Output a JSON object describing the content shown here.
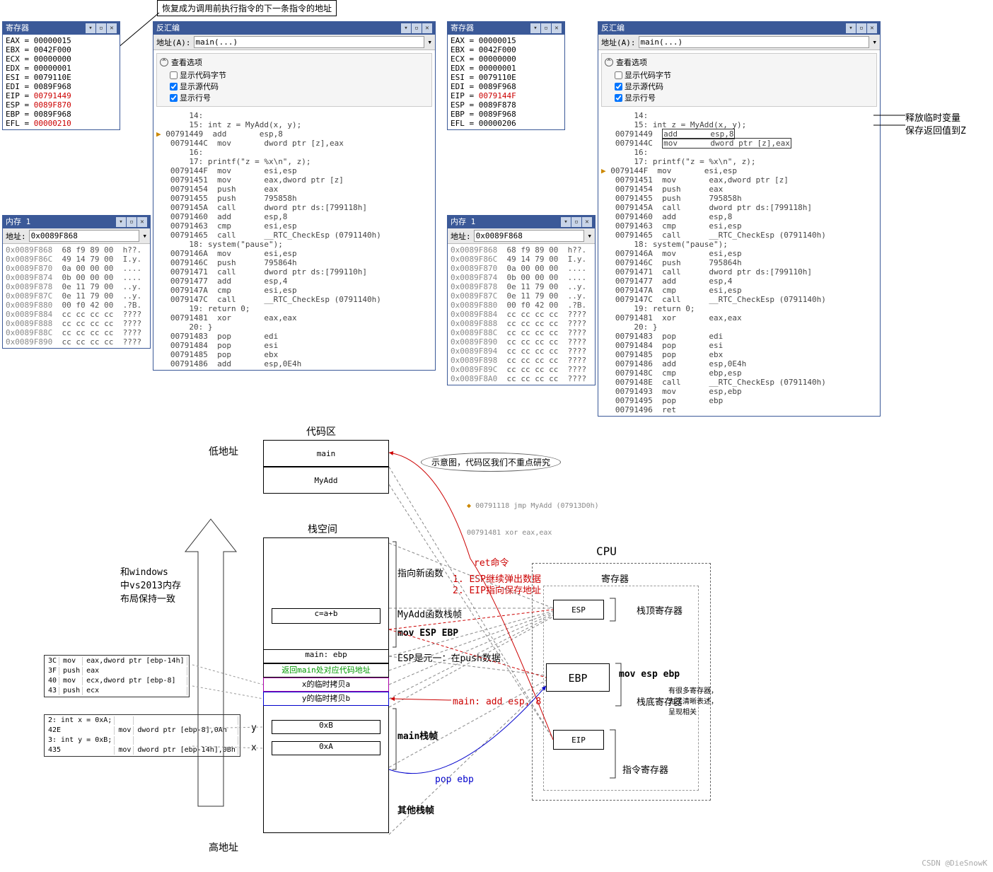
{
  "annot_top": "恢复成为调用前执行指令的下一条指令的地址",
  "annot_right1": "释放临时变量",
  "annot_right2": "保存返回值到Z",
  "left": {
    "registers": {
      "title": "寄存器",
      "lines": [
        {
          "t": "EAX = 00000015"
        },
        {
          "t": "EBX = 0042F000"
        },
        {
          "t": "ECX = 00000000"
        },
        {
          "t": "EDX = 00000001"
        },
        {
          "t": "ESI = 0079110E"
        },
        {
          "t": "EDI = 0089F968"
        },
        {
          "t": "EIP = ",
          "v": "00791449",
          "hl": true
        },
        {
          "t": "ESP = ",
          "v": "0089F870",
          "hl": true
        },
        {
          "t": "EBP = 0089F968"
        },
        {
          "t": "EFL = ",
          "v": "00000210",
          "hl": true
        }
      ]
    },
    "memory": {
      "title": "内存 1",
      "addr_label": "地址:",
      "addr_value": "0x0089F868",
      "lines": [
        [
          "0x0089F868",
          "68 f9 89 00",
          "h??."
        ],
        [
          "0x0089F86C",
          "49 14 79 00",
          "I.y."
        ],
        [
          "0x0089F870",
          "0a 00 00 00",
          "...."
        ],
        [
          "0x0089F874",
          "0b 00 00 00",
          "...."
        ],
        [
          "0x0089F878",
          "0e 11 79 00",
          "..y."
        ],
        [
          "0x0089F87C",
          "0e 11 79 00",
          "..y."
        ],
        [
          "0x0089F880",
          "00 f0 42 00",
          ".?B."
        ],
        [
          "0x0089F884",
          "cc cc cc cc",
          "????"
        ],
        [
          "0x0089F888",
          "cc cc cc cc",
          "????"
        ],
        [
          "0x0089F88C",
          "cc cc cc cc",
          "????"
        ],
        [
          "0x0089F890",
          "cc cc cc cc",
          "????"
        ]
      ]
    },
    "disasm": {
      "title": "反汇编",
      "addr_label": "地址(A):",
      "addr_value": "main(...)",
      "opts_title": "查看选项",
      "opt1": "显示代码字节",
      "opt2": "显示源代码",
      "opt3": "显示行号",
      "lines": [
        "      14:",
        "      15: int z = MyAdd(x, y);",
        "▶ 00791449  add       esp,8",
        "  0079144C  mov       dword ptr [z],eax",
        "      16:",
        "      17: printf(\"z = %x\\n\", z);",
        "  0079144F  mov       esi,esp",
        "  00791451  mov       eax,dword ptr [z]",
        "  00791454  push      eax",
        "  00791455  push      795858h",
        "  0079145A  call      dword ptr ds:[799118h]",
        "  00791460  add       esp,8",
        "  00791463  cmp       esi,esp",
        "  00791465  call      __RTC_CheckEsp (0791140h)",
        "      18: system(\"pause\");",
        "  0079146A  mov       esi,esp",
        "  0079146C  push      795864h",
        "  00791471  call      dword ptr ds:[799110h]",
        "  00791477  add       esp,4",
        "  0079147A  cmp       esi,esp",
        "  0079147C  call      __RTC_CheckEsp (0791140h)",
        "      19: return 0;",
        "  00791481  xor       eax,eax",
        "      20: }",
        "  00791483  pop       edi",
        "  00791484  pop       esi",
        "  00791485  pop       ebx",
        "  00791486  add       esp,0E4h"
      ]
    }
  },
  "right": {
    "registers": {
      "title": "寄存器",
      "lines": [
        {
          "t": "EAX = 00000015"
        },
        {
          "t": "EBX = 0042F000"
        },
        {
          "t": "ECX = 00000000"
        },
        {
          "t": "EDX = 00000001"
        },
        {
          "t": "ESI = 0079110E"
        },
        {
          "t": "EDI = 0089F968"
        },
        {
          "t": "EIP = ",
          "v": "0079144F",
          "hl": true
        },
        {
          "t": "ESP = 0089F878"
        },
        {
          "t": "EBP = 0089F968"
        },
        {
          "t": "EFL = 00000206"
        }
      ]
    },
    "memory": {
      "title": "内存 1",
      "addr_label": "地址:",
      "addr_value": "0x0089F868",
      "lines": [
        [
          "0x0089F868",
          "68 f9 89 00",
          "h??."
        ],
        [
          "0x0089F86C",
          "49 14 79 00",
          "I.y."
        ],
        [
          "0x0089F870",
          "0a 00 00 00",
          "...."
        ],
        [
          "0x0089F874",
          "0b 00 00 00",
          "...."
        ],
        [
          "0x0089F878",
          "0e 11 79 00",
          "..y."
        ],
        [
          "0x0089F87C",
          "0e 11 79 00",
          "..y."
        ],
        [
          "0x0089F880",
          "00 f0 42 00",
          ".?B."
        ],
        [
          "0x0089F884",
          "cc cc cc cc",
          "????"
        ],
        [
          "0x0089F888",
          "cc cc cc cc",
          "????"
        ],
        [
          "0x0089F88C",
          "cc cc cc cc",
          "????"
        ],
        [
          "0x0089F890",
          "cc cc cc cc",
          "????"
        ],
        [
          "0x0089F894",
          "cc cc cc cc",
          "????"
        ],
        [
          "0x0089F898",
          "cc cc cc cc",
          "????"
        ],
        [
          "0x0089F89C",
          "cc cc cc cc",
          "????"
        ],
        [
          "0x0089F8A0",
          "cc cc cc cc",
          "????"
        ]
      ]
    },
    "disasm": {
      "title": "反汇编",
      "addr_label": "地址(A):",
      "addr_value": "main(...)",
      "opts_title": "查看选项",
      "opt1": "显示代码字节",
      "opt2": "显示源代码",
      "opt3": "显示行号",
      "hl1": "add       esp,8",
      "hl2": "mov       dword ptr [z],eax",
      "lines": [
        "      14:",
        "      15: int z = MyAdd(x, y);",
        "  00791449  ",
        "  0079144C  ",
        "      16:",
        "      17: printf(\"z = %x\\n\", z);",
        "▶ 0079144F  mov       esi,esp",
        "  00791451  mov       eax,dword ptr [z]",
        "  00791454  push      eax",
        "  00791455  push      795858h",
        "  0079145A  call      dword ptr ds:[799118h]",
        "  00791460  add       esp,8",
        "  00791463  cmp       esi,esp",
        "  00791465  call      __RTC_CheckEsp (0791140h)",
        "      18: system(\"pause\");",
        "  0079146A  mov       esi,esp",
        "  0079146C  push      795864h",
        "  00791471  call      dword ptr ds:[799110h]",
        "  00791477  add       esp,4",
        "  0079147A  cmp       esi,esp",
        "  0079147C  call      __RTC_CheckEsp (0791140h)",
        "      19: return 0;",
        "  00791481  xor       eax,eax",
        "      20: }",
        "  00791483  pop       edi",
        "  00791484  pop       esi",
        "  00791485  pop       ebx",
        "  00791486  add       esp,0E4h",
        "  0079148C  cmp       ebp,esp",
        "  0079148E  call      __RTC_CheckEsp (0791140h)",
        "  00791493  mov       esp,ebp",
        "  00791495  pop       ebp",
        "  00791496  ret"
      ]
    }
  },
  "diagram": {
    "low_addr": "低地址",
    "high_addr": "高地址",
    "code_area": "代码区",
    "main": "main",
    "myadd": "MyAdd",
    "stack_space": "栈空间",
    "cab": "c=a+b",
    "main_ebp": "main: ebp",
    "ret_addr": "返回main处对应代码地址",
    "x_copy": "x的临时拷贝a",
    "y_copy": "y的临时拷贝b",
    "oxb": "0xB",
    "oxa": "0xA",
    "other_frame": "其他栈帧",
    "point_new": "指向新函数",
    "myadd_frame": "MyAdd函数栈帧",
    "mov_esp_ebp": "mov ESP EBP",
    "esp_push": "ESP是元一：在push数据",
    "main_add": "main: add esp, 8",
    "main_frame": "main栈帧",
    "pop_ebp": "pop ebp",
    "ret_cmd": "ret命令",
    "ret1": "1. ESP继续弹出数据",
    "ret2": "2. EIP指向保存地址",
    "cpu": "CPU",
    "regs": "寄存器",
    "esp": "ESP",
    "ebp": "EBP",
    "eip": "EIP",
    "stack_top": "栈顶寄存器",
    "stack_bot": "栈底寄存器",
    "instr_reg": "指令寄存器",
    "mov_esp_ebp2": "mov esp ebp",
    "note_right": "有很多寄存器，\n为了清晰表述，\n呈现相关",
    "note_left": "和windows\n中vs2013内存\n布局保持一致",
    "balloon": "示意图，代码区我们不重点研究",
    "jmp_line": "00791118  jmp       MyAdd (07913D0h)",
    "xor_line": "00791481  xor       eax,eax",
    "code1": [
      [
        "3C",
        "mov",
        "eax,dword ptr [ebp-14h]"
      ],
      [
        "3F",
        "push",
        "eax"
      ],
      [
        "40",
        "mov",
        "ecx,dword ptr [ebp-8]"
      ],
      [
        "43",
        "push",
        "ecx"
      ]
    ],
    "code2": [
      [
        "2: int x = 0xA;",
        "",
        ""
      ],
      [
        "42E",
        "mov",
        "dword ptr [ebp-8],0Ah"
      ],
      [
        "3: int y = 0xB;",
        "",
        ""
      ],
      [
        "435",
        "mov",
        "dword ptr [ebp-14h],0Bh"
      ]
    ],
    "x": "x",
    "y": "y"
  },
  "watermark": "CSDN @DieSnowK"
}
